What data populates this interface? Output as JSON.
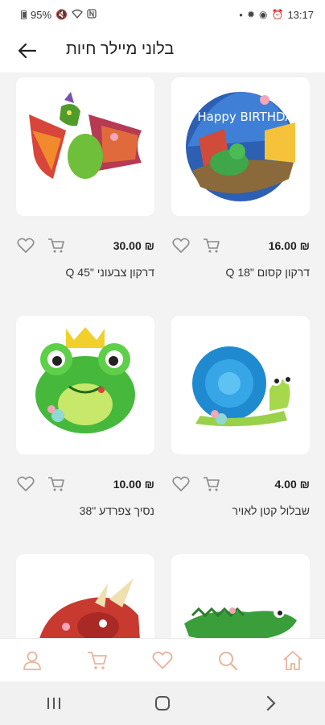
{
  "status_bar": {
    "battery": "95%",
    "time": "13:17"
  },
  "header": {
    "title": "בלוני מיילר חיות"
  },
  "products": [
    {
      "name": "דרקון קסום \"18 Q",
      "price": "16.00 ₪",
      "image_text": "Happy BIRTHDAY"
    },
    {
      "name": "דרקון צבעוני \"45 Q",
      "price": "30.00 ₪"
    },
    {
      "name": "שבלול קטן לאויר",
      "price": "4.00 ₪"
    },
    {
      "name": "נסיך צפרדע \"38",
      "price": "10.00 ₪"
    },
    {
      "name": "",
      "price": ""
    },
    {
      "name": "",
      "price": ""
    }
  ],
  "colors": {
    "accent": "#e8b49c",
    "icon_gray": "#8a8a8a"
  }
}
